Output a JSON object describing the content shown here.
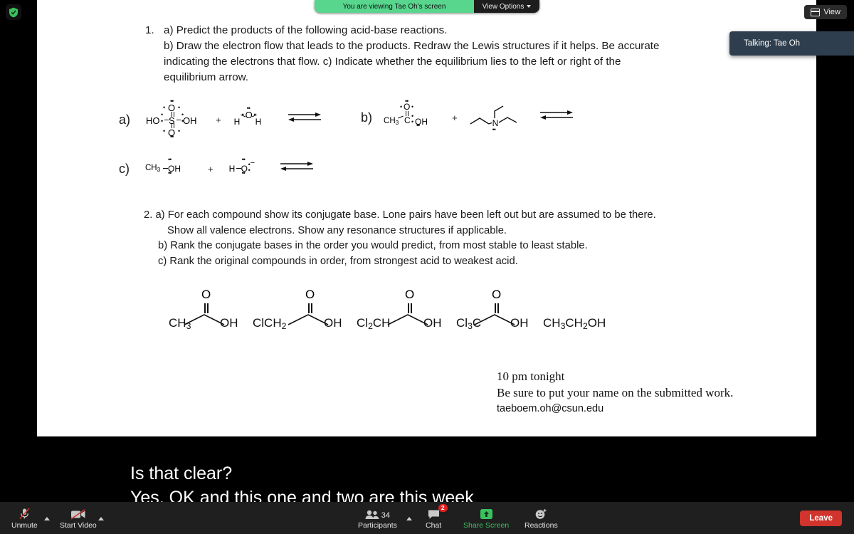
{
  "meeting": {
    "encryption_icon": "shield-check-icon",
    "share_banner": {
      "viewing_text": "You are viewing Tae Oh's screen",
      "view_options_label": "View Options",
      "green": "#58d68d"
    },
    "view_button": {
      "label": "View",
      "icon": "grid-view-icon"
    },
    "talking_indicator": "Talking: Tae Oh"
  },
  "slide": {
    "question1": {
      "number": "1.",
      "lines": [
        "a) Predict the products of the following acid-base reactions.",
        "b) Draw the electron flow that leads to the products. Redraw the Lewis structures if it helps. Be accurate",
        "indicating the electrons that flow. c) Indicate whether the equilibrium lies to the left or right of the",
        "equilibrium arrow."
      ]
    },
    "reactions": [
      {
        "label": "a)",
        "reactant1": {
          "formula": "HO-S(=O)(=O)-OH",
          "left": "HO",
          "center": "S",
          "right": "OH",
          "top": "O",
          "bottom": "O"
        },
        "plus": "+",
        "reactant2": {
          "formula": "H-O-H",
          "left": "H",
          "center": "O",
          "right": "H"
        },
        "arrow": "equilibrium-arrows"
      },
      {
        "label": "b)",
        "reactant1": {
          "formula": "CH3-C(=O)-OH",
          "left": "CH",
          "left_sub": "3",
          "center": "C",
          "right": "OH",
          "top": "O"
        },
        "plus": "+",
        "reactant2": {
          "formula": "triethylamine",
          "center": "N"
        },
        "arrow": "equilibrium-arrows"
      },
      {
        "label": "c)",
        "reactant1": {
          "formula": "CH3-OH",
          "left": "CH",
          "left_sub": "3",
          "right": "OH"
        },
        "plus": "+",
        "reactant2": {
          "formula": "H-O minus",
          "left": "H",
          "center": "O",
          "charge": "−"
        },
        "arrow": "equilibrium-arrows"
      }
    ],
    "question2": {
      "lines": [
        "2. a) For each compound show its conjugate base. Lone pairs have been left out but are assumed to be there.",
        "Show all valence electrons. Show any resonance structures if applicable.",
        "b) Rank the conjugate bases in the order you would predict, from most stable to least stable.",
        "c) Rank the original compounds in order, from strongest acid to weakest acid."
      ]
    },
    "acids": [
      {
        "left": "CH",
        "left_sub": "3",
        "right": "OH",
        "top": "O",
        "name": "acetic-acid"
      },
      {
        "left": "ClCH",
        "left_sub": "2",
        "right": "OH",
        "top": "O",
        "name": "chloroacetic-acid"
      },
      {
        "left": "Cl",
        "left_sub": "2",
        "left_tail": "CH",
        "right": "OH",
        "top": "O",
        "name": "dichloroacetic-acid"
      },
      {
        "left": "Cl",
        "left_sub": "3",
        "left_tail": "C",
        "right": "OH",
        "top": "O",
        "name": "trichloroacetic-acid"
      },
      {
        "plain": "CH3CH2OH",
        "name": "ethanol"
      }
    ],
    "note": {
      "line1": "10 pm tonight",
      "line2": "Be sure to put your name on the submitted work.",
      "email": "taeboem.oh@csun.edu"
    }
  },
  "captions": {
    "line1": "Is that clear?",
    "line2": "Yes, OK and this one and two are this week"
  },
  "toolbar": {
    "mute": {
      "label": "Unmute",
      "icon": "microphone-muted-icon"
    },
    "video": {
      "label": "Start Video",
      "icon": "camera-off-icon"
    },
    "participants": {
      "label": "Participants",
      "count": "34",
      "icon": "people-icon"
    },
    "chat": {
      "label": "Chat",
      "badge": "2",
      "icon": "chat-bubble-icon"
    },
    "share": {
      "label": "Share Screen",
      "icon": "share-up-arrow-icon",
      "color": "#3ac15e"
    },
    "reactions": {
      "label": "Reactions",
      "icon": "smiley-plus-icon"
    },
    "leave": {
      "label": "Leave",
      "color": "#d0342c"
    }
  }
}
